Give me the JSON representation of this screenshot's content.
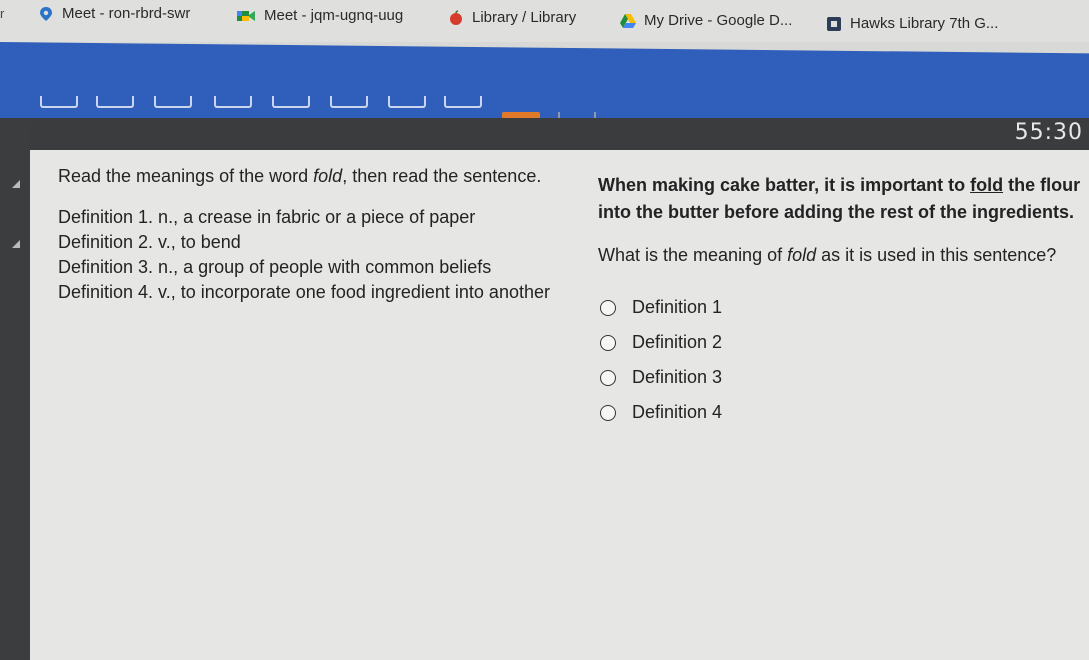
{
  "bookmarks": [
    {
      "label": "Meet - ron-rbrd-swr",
      "icon": "location-pin-icon"
    },
    {
      "label": "Meet - jqm-ugnq-uug",
      "icon": "meet-camera-icon"
    },
    {
      "label": "Library / Library",
      "icon": "apple-icon"
    },
    {
      "label": "My Drive - Google D...",
      "icon": "google-drive-icon"
    },
    {
      "label": "Hawks Library 7th G...",
      "icon": "library-icon"
    }
  ],
  "bookmark_edge_text": "r",
  "timer": "55:30",
  "prompt": {
    "intro_start": "Read the meanings of the word ",
    "intro_word": "fold",
    "intro_end": ", then read the sentence.",
    "definitions": [
      "Definition 1. n., a crease in fabric or a piece of paper",
      "Definition 2. v., to bend",
      "Definition 3. n., a group of people with common beliefs",
      "Definition 4. v., to incorporate one food ingredient into another"
    ]
  },
  "passage": {
    "before": "When making cake batter, it is important to ",
    "word": "fold",
    "after": " the flour into the butter before adding the rest of the ingredients."
  },
  "question": {
    "before": "What is the meaning of ",
    "word": "fold",
    "after": " as it is used in this sentence?"
  },
  "choices": [
    "Definition 1",
    "Definition 2",
    "Definition 3",
    "Definition 4"
  ],
  "colors": {
    "header_blue": "#2f5fba",
    "progress_active": "#e07a2a",
    "dark_bar": "#3a3c3d",
    "content_bg": "#e6e7e5"
  }
}
